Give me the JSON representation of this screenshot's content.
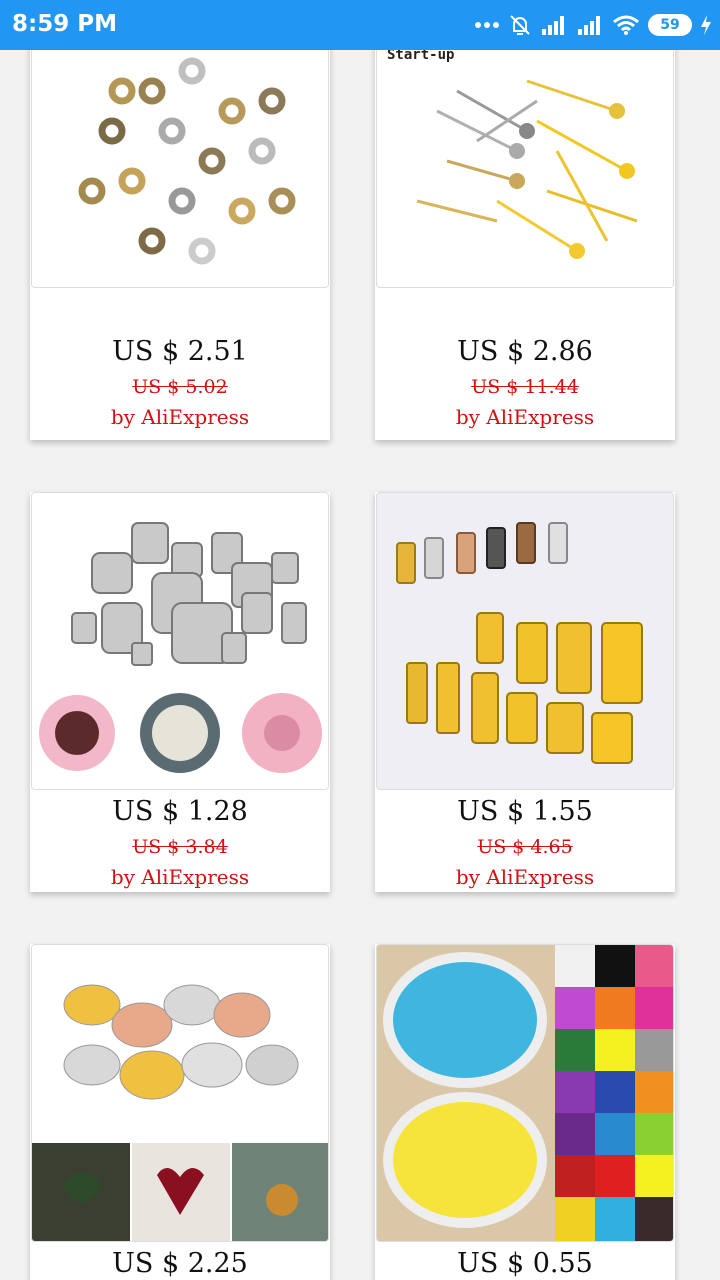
{
  "status_bar": {
    "time": "8:59 PM",
    "battery": "59",
    "icons": [
      "more-dots-icon",
      "alarm-off-icon",
      "signal-icon",
      "signal-icon",
      "wifi-icon",
      "battery-icon",
      "charging-icon"
    ]
  },
  "products": [
    {
      "name": "daisy-spacer-beads",
      "price": "US $ 2.51",
      "old_price": "US $ 5.02",
      "seller": "by AliExpress",
      "image_caption": ""
    },
    {
      "name": "earring-post-pins",
      "price": "US $ 2.86",
      "old_price": "US $ 11.44",
      "seller": "by AliExpress",
      "image_caption": "Start-up"
    },
    {
      "name": "end-cap-tubes",
      "price": "US $ 1.28",
      "old_price": "US $ 3.84",
      "seller": "by AliExpress",
      "image_caption": ""
    },
    {
      "name": "cord-end-clasps",
      "price": "US $ 1.55",
      "old_price": "US $ 4.65",
      "seller": "by AliExpress",
      "image_caption": ""
    },
    {
      "name": "earring-stud-blanks",
      "price": "US $ 2.25",
      "old_price": "",
      "seller": "",
      "image_caption": ""
    },
    {
      "name": "nylon-cord-spools",
      "price": "US $ 0.55",
      "old_price": "",
      "seller": "",
      "image_caption": ""
    }
  ],
  "colors": {
    "status_bar": "#2196f3",
    "sale_red": "#d21010",
    "background": "#f2f2f2"
  }
}
